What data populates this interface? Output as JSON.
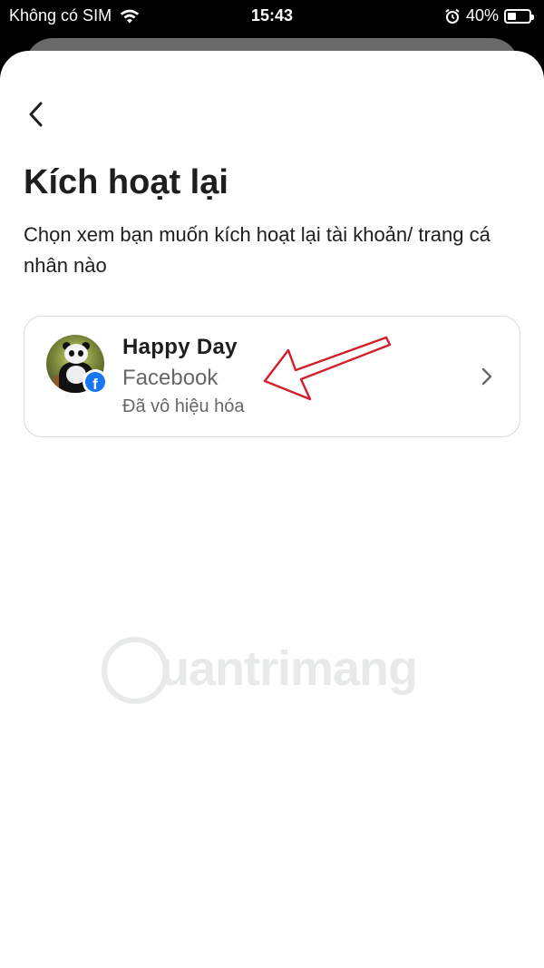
{
  "status_bar": {
    "carrier": "Không có SIM",
    "time": "15:43",
    "battery_text": "40%",
    "battery_level": 0.4,
    "icons": [
      "wifi-icon",
      "alarm-icon",
      "battery-icon"
    ]
  },
  "nav": {
    "back_icon": "chevron-left-icon"
  },
  "header": {
    "title": "Kích hoạt lại",
    "subtitle": "Chọn xem bạn muốn kích hoạt lại tài khoản/ trang cá nhân nào"
  },
  "account": {
    "name": "Happy Day",
    "platform": "Facebook",
    "status": "Đã vô hiệu hóa",
    "badge_letter": "f",
    "badge_icon": "facebook-icon",
    "chevron_icon": "chevron-right-icon"
  },
  "annotation": {
    "icon": "red-arrow-icon",
    "color": "#d0202a"
  },
  "watermark": {
    "text": "uantrimang",
    "icon": "lightbulb-icon"
  },
  "colors": {
    "text_primary": "#1c1e21",
    "text_secondary": "#65676b",
    "facebook_blue": "#1877f2",
    "card_border": "#d6d9dd"
  }
}
